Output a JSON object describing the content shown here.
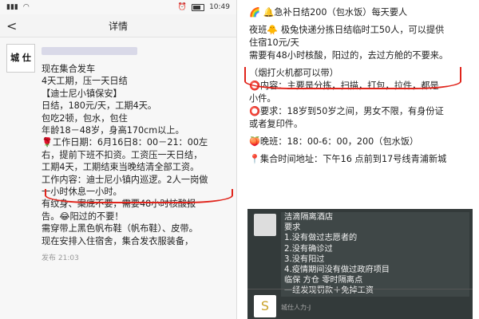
{
  "left": {
    "status": {
      "time": "10:49"
    },
    "nav": {
      "back": "<",
      "title": "详情"
    },
    "post": {
      "avatar_text": "城 仕",
      "lines": [
        "现在集合发车",
        "4天工期，压一天日结",
        "【迪士尼小镇保安】",
        "日结，180元/天，工期4天。",
        "包吃2顿，包水，包住",
        "年龄18－48岁，身高170cm以上。",
        "🌹工作日期：6月16日8：00－21：00左",
        "右，提前下班不扣资。工资压一天日结，",
        "工期4天，工期结束当晚结清全部工资。",
        "工作内容：迪士尼小镇内巡逻。2人一岗做",
        "一小时休息一小时。",
        "有纹身、案底不要，需要48小时核酸报",
        "告。😂阳过的不要！",
        "需穿带上黑色帆布鞋（帆布鞋）、皮带。",
        "现在安排入住宿舍，集合发衣服装备，"
      ],
      "timestamp": "发布  21:03"
    }
  },
  "right": {
    "lines": [
      "🌈 🔔急补日结200（包水饭）每天要人",
      "",
      "夜班🐥 极兔快递分拣日结临时工50人，可以提供",
      "住宿10元/天",
      "需要有48小时核酸，阳过的，去过方舱的不要来。",
      "",
      "（烟打火机都可以带）",
      "⭕内容：主要是分拣，扫描，打包，拉件，都是",
      "小件。",
      "⭕要求：18岁到50岁之间，男女不限，有身份证",
      "或者复印件。",
      "",
      "🍑晚班：18：00-6：00，200（包水饭）",
      "",
      "📍集合时间地址：下午16 点前到17号线青浦新城"
    ],
    "chat": {
      "bubble": [
        "洁滴隔离酒店",
        "要求",
        "1.没有做过志愿者的",
        "2.没有确诊过",
        "3.没有阳过",
        "4.疫情期间没有做过政府项目",
        "临保  方仓  零时隔离点",
        "一经发现罚款＋免掉工资"
      ],
      "name": "城仕人力-J",
      "avatar_glyph": "S"
    }
  }
}
